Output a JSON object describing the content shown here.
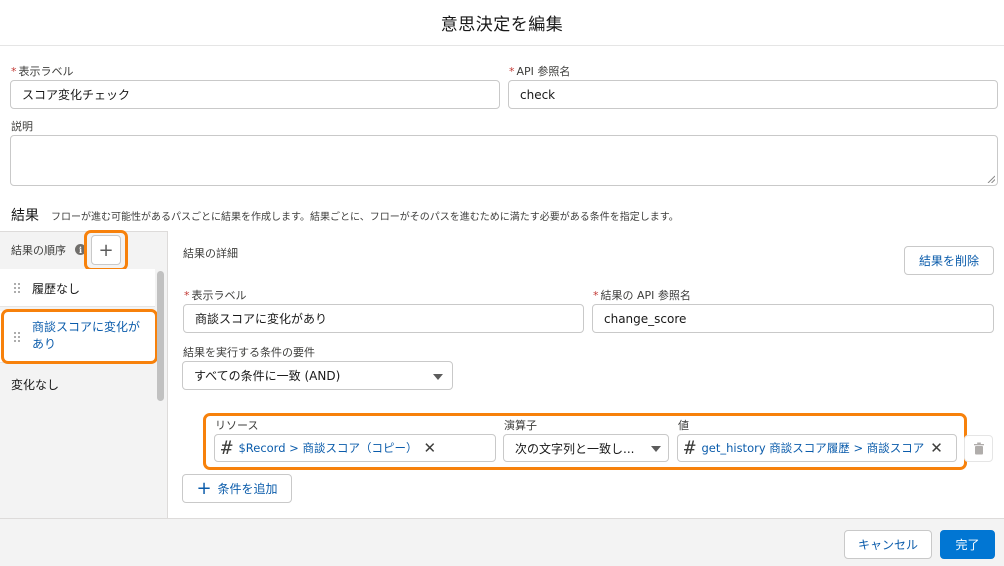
{
  "modal": {
    "title": "意思決定を編集"
  },
  "form": {
    "label_field": {
      "label": "表示ラベル",
      "value": "スコア変化チェック"
    },
    "api_field": {
      "label": "API 参照名",
      "value": "check"
    },
    "description_field": {
      "label": "説明",
      "value": ""
    }
  },
  "outcomes_section": {
    "title": "結果",
    "description": "フローが進む可能性があるパスごとに結果を作成します。結果ごとに、フローがそのパスを進むために満たす必要がある条件を指定します。",
    "order_label": "結果の順序",
    "info_icon": "i",
    "add_icon": "+",
    "items": [
      {
        "label": "履歴なし"
      },
      {
        "label": "商談スコアに変化があり"
      },
      {
        "label": "変化なし"
      }
    ]
  },
  "detail": {
    "heading": "結果の詳細",
    "delete_button": "結果を削除",
    "label_field": {
      "label": "表示ラベル",
      "value": "商談スコアに変化があり"
    },
    "api_field": {
      "label": "結果の API 参照名",
      "value": "change_score"
    },
    "condition_requirement": {
      "label": "結果を実行する条件の要件",
      "value": "すべての条件に一致 (AND)"
    },
    "condition": {
      "resource_label": "リソース",
      "operator_label": "演算子",
      "value_label": "値",
      "resource_value": "$Record > 商談スコア（コピー）",
      "operator_value": "次の文字列と一致し...",
      "value_value": "get_history 商談スコア履歴 > 商談スコア"
    },
    "add_condition_button": "条件を追加",
    "add_condition_icon": "+"
  },
  "footer": {
    "cancel_button": "キャンセル",
    "done_button": "完了"
  },
  "icons": {
    "resource_icon": "#",
    "value_icon": "#",
    "clear_icon": "✕"
  },
  "colors": {
    "highlight": "#f7810b",
    "brand": "#0176d3",
    "link": "#0b5cab",
    "required": "#c23934"
  }
}
